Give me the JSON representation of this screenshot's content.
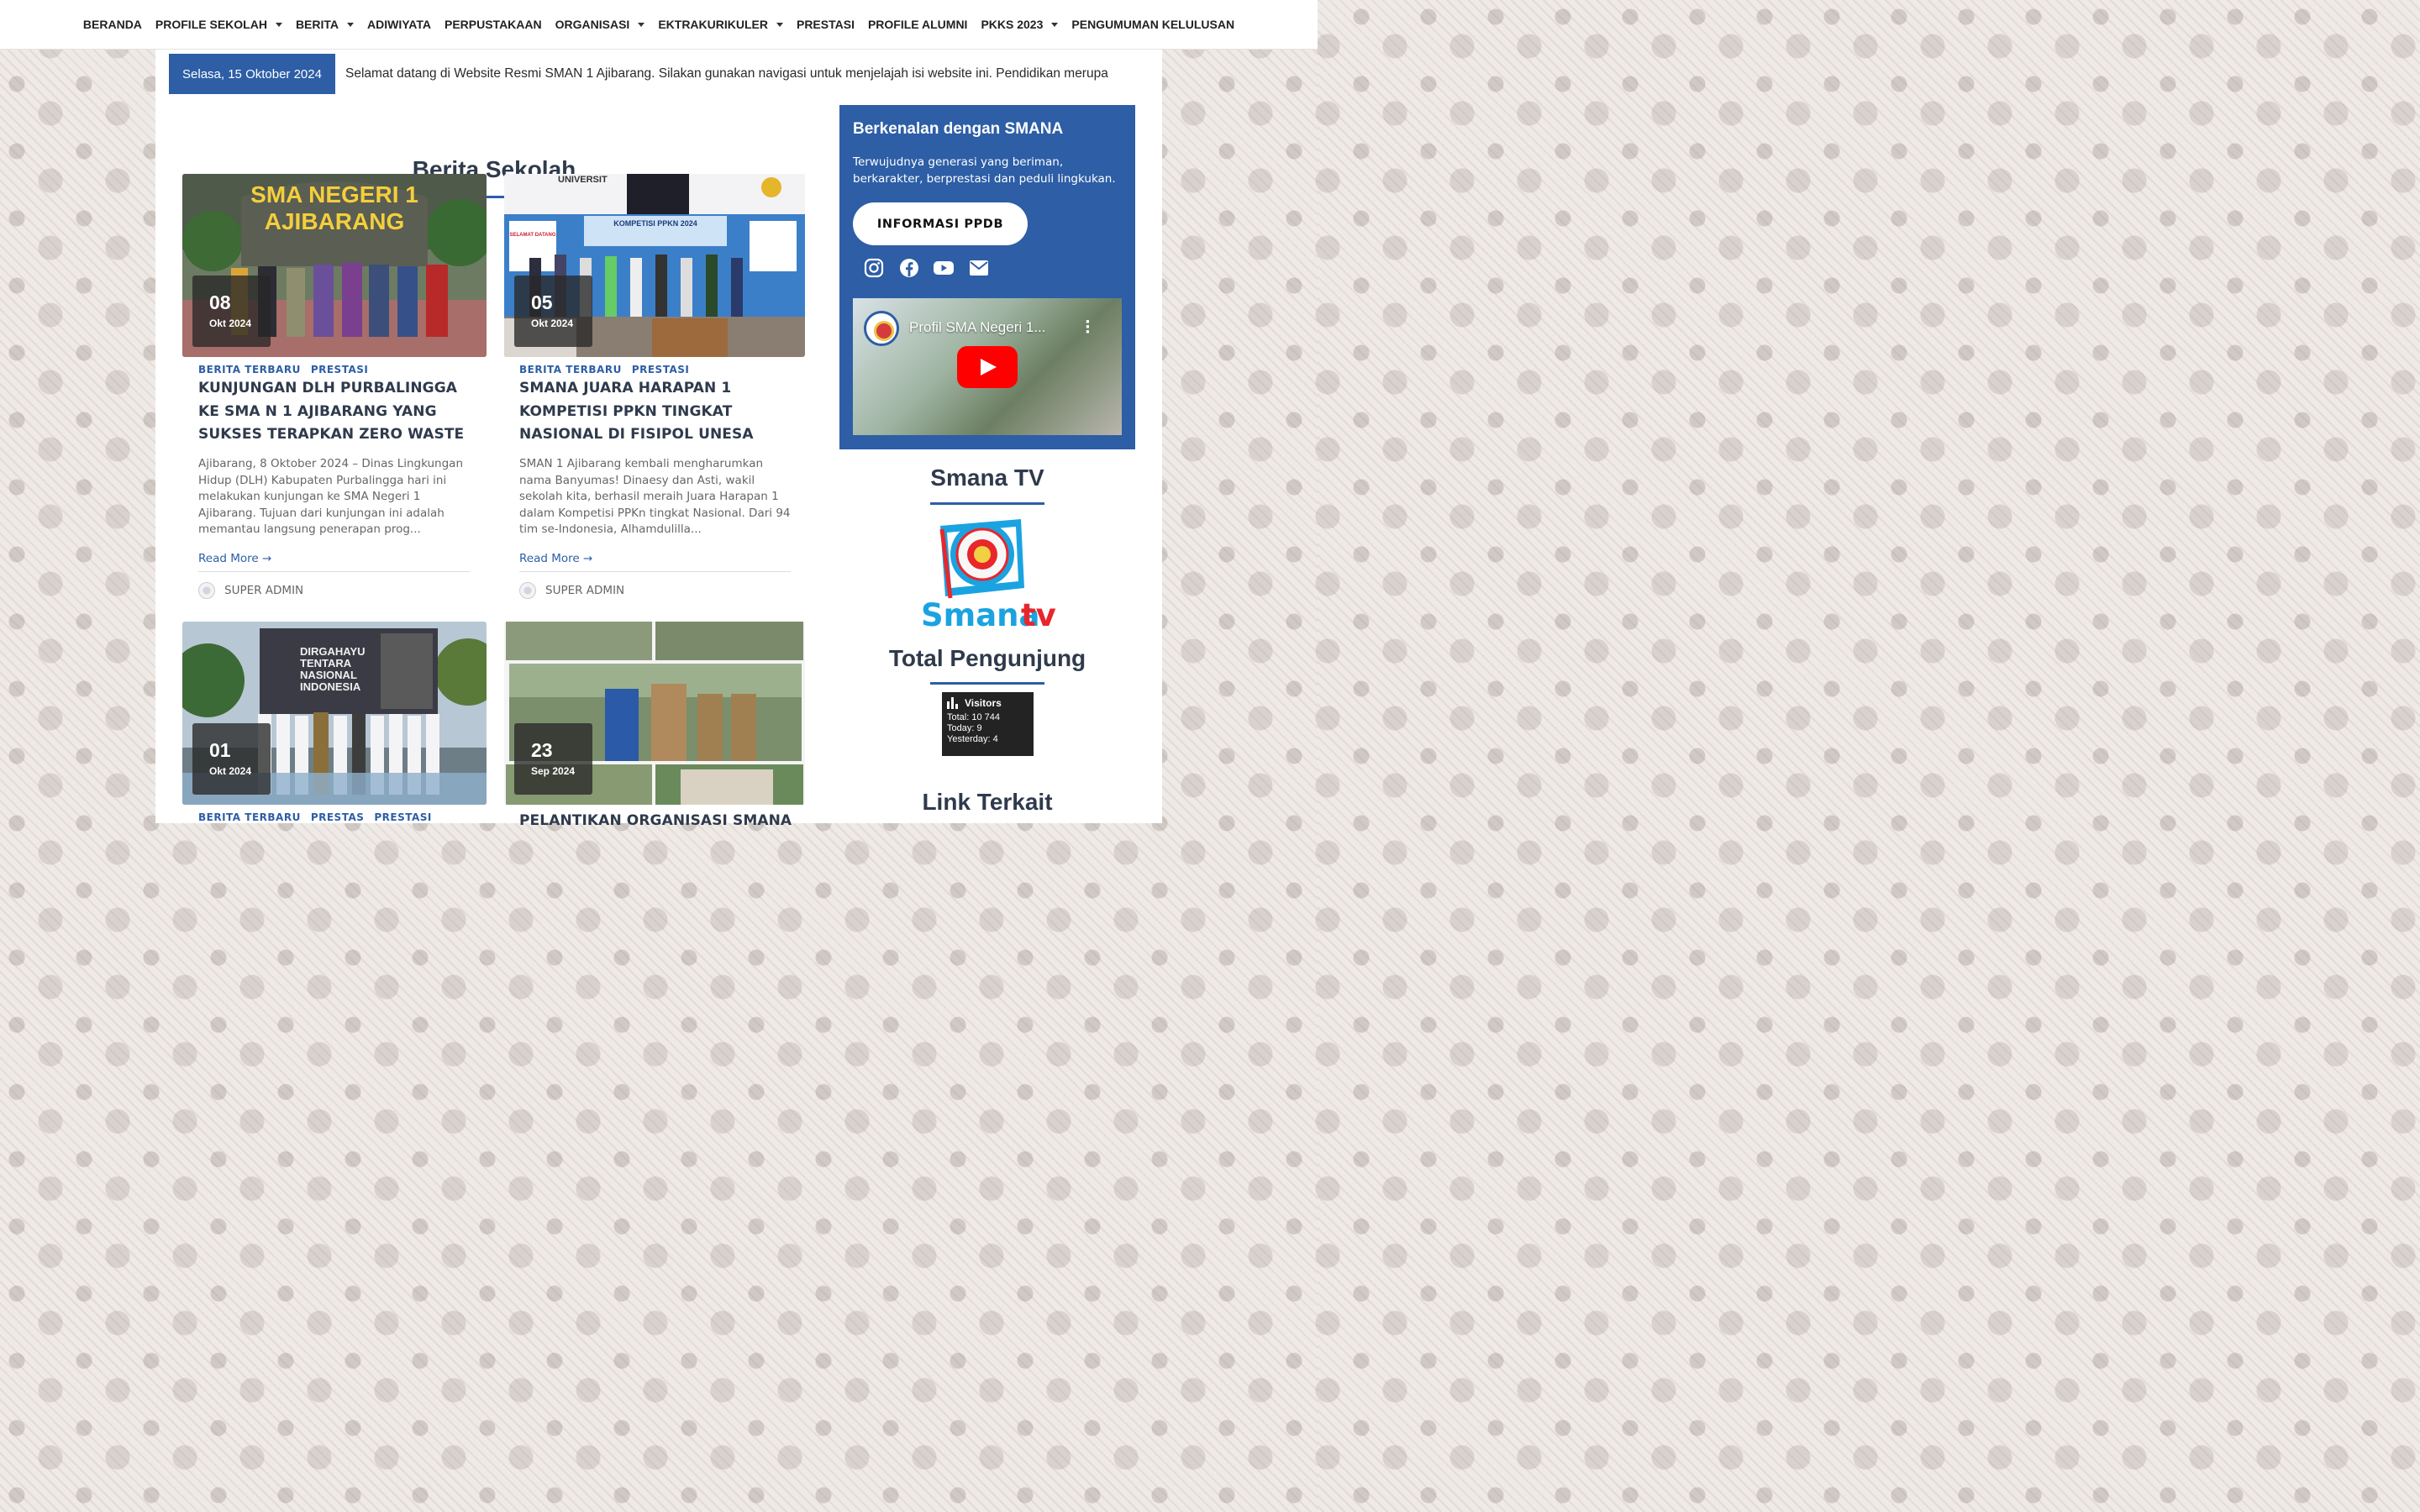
{
  "nav": {
    "items": [
      {
        "label": "BERANDA",
        "dropdown": false
      },
      {
        "label": "PROFILE SEKOLAH",
        "dropdown": true
      },
      {
        "label": "BERITA",
        "dropdown": true
      },
      {
        "label": "ADIWIYATA",
        "dropdown": false
      },
      {
        "label": "PERPUSTAKAAN",
        "dropdown": false
      },
      {
        "label": "ORGANISASI",
        "dropdown": true
      },
      {
        "label": "EKTRAKURIKULER",
        "dropdown": true
      },
      {
        "label": "PRESTASI",
        "dropdown": false
      },
      {
        "label": "PROFILE ALUMNI",
        "dropdown": false
      },
      {
        "label": "PKKS 2023",
        "dropdown": true
      },
      {
        "label": "PENGUMUMAN KELULUSAN",
        "dropdown": false
      }
    ]
  },
  "topbar": {
    "date": "Selasa, 15 Oktober 2024",
    "ticker": "Selamat datang di Website Resmi SMAN 1 Ajibarang. Silakan gunakan navigasi untuk menjelajah isi website ini. Pendidikan merupa"
  },
  "news": {
    "title": "Berita Sekolah",
    "posts": [
      {
        "day": "08",
        "month": "Okt 2024",
        "categories": [
          "BERITA TERBARU",
          "PRESTASI"
        ],
        "title": "KUNJUNGAN DLH PURBALINGGA KE SMA N 1 AJIBARANG YANG SUKSES TERAPKAN ZERO WASTE",
        "excerpt": "Ajibarang, 8 Oktober 2024 – Dinas Lingkungan Hidup (DLH) Kabupaten Purbalingga hari ini melakukan kunjungan ke SMA Negeri 1 Ajibarang. Tujuan dari kunjungan ini adalah memantau langsung penerapan prog...",
        "read_more": "Read More →",
        "author": "SUPER ADMIN",
        "image_text": [
          "SMA NEGERI 1",
          "AJIBARANG"
        ]
      },
      {
        "day": "05",
        "month": "Okt 2024",
        "categories": [
          "BERITA TERBARU",
          "PRESTASI"
        ],
        "title": "SMANA JUARA HARAPAN 1 KOMPETISI PPKN TINGKAT NASIONAL DI FISIPOL UNESA",
        "excerpt": "SMAN 1 Ajibarang kembali mengharumkan nama Banyumas! Dinaesy dan Asti, wakil sekolah kita, berhasil meraih Juara Harapan 1 dalam Kompetisi PPKn tingkat Nasional. Dari 94 tim se-Indonesia, Alhamdulilla...",
        "read_more": "Read More →",
        "author": "SUPER ADMIN",
        "image_text": [
          "UNIVERSIT",
          "KOMPETISI PPKN 2024",
          "SELAMAT DATANG"
        ]
      },
      {
        "day": "01",
        "month": "Okt 2024",
        "categories": [
          "BERITA TERBARU",
          "PRESTAS",
          "PRESTASI"
        ],
        "image_text": [
          "DIRGAHAYU",
          "TENTARA",
          "NASIONAL",
          "INDONESIA"
        ]
      },
      {
        "day": "23",
        "month": "Sep 2024",
        "title": "PELANTIKAN ORGANISASI SMANA"
      }
    ]
  },
  "intro": {
    "title": "Berkenalan dengan SMANA",
    "text": "Terwujudnya generasi yang beriman, berkarakter, berprestasi dan peduli lingkukan.",
    "button": "INFORMASI PPDB",
    "video_title": "Profil SMA Negeri 1..."
  },
  "social_icons": [
    "instagram-icon",
    "facebook-icon",
    "youtube-icon",
    "mail-icon"
  ],
  "smana_tv": {
    "title": "Smana TV",
    "logo_text_left": "Smana",
    "logo_text_right": "tv"
  },
  "visitors": {
    "title": "Total Pengunjung",
    "widget_label": "Visitors",
    "total": "Total: 10 744",
    "today": "Today: 9",
    "yesterday": "Yesterday: 4"
  },
  "links": {
    "title": "Link Terkait"
  },
  "colors": {
    "accent": "#2d5ea6",
    "heading": "#2f3a4c",
    "youtube": "#ff0000",
    "tv_red": "#e8262b",
    "tv_cyan": "#1aa3e0"
  }
}
